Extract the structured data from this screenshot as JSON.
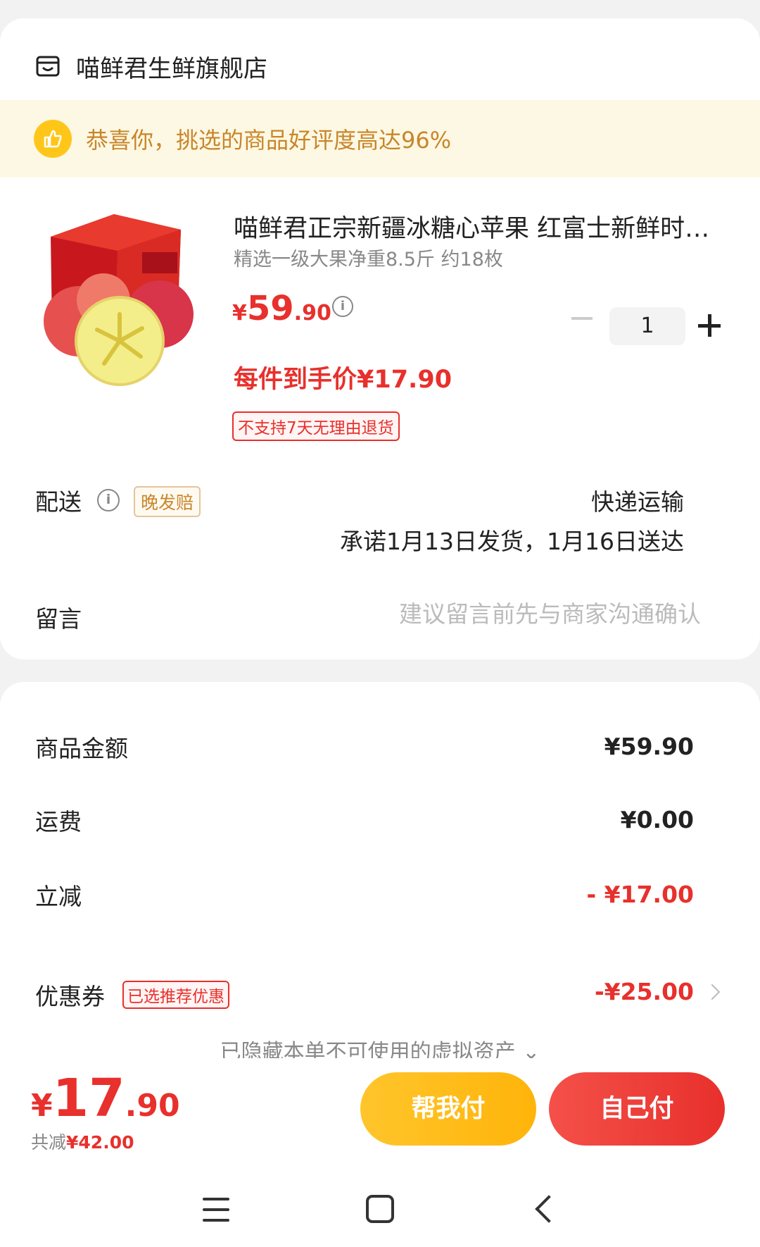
{
  "shop": {
    "name": "喵鲜君生鲜旗舰店",
    "icon": "shop-icon"
  },
  "banner": {
    "text": "恭喜你，挑选的商品好评度高达96%",
    "icon": "thumbs-up-icon"
  },
  "product": {
    "title": "喵鲜君正宗新疆冰糖心苹果 红富士新鲜时令水果",
    "spec": "精选一级大果净重8.5斤 约18枚",
    "price_currency": "¥",
    "price_int": "59",
    "price_dec": ".90",
    "unit_price": "每件到手价¥17.90",
    "return_policy": "不支持7天无理由退货",
    "quantity": "1"
  },
  "shipping": {
    "label": "配送",
    "late_badge": "晚发赔",
    "method": "快递运输",
    "promise": "承诺1月13日发货，1月16日送达"
  },
  "message": {
    "label": "留言",
    "placeholder": "建议留言前先与商家沟通确认",
    "value": ""
  },
  "summary": {
    "goods_label": "商品金额",
    "goods_value": "¥59.90",
    "freight_label": "运费",
    "freight_value": "¥0.00",
    "discount_label": "立减",
    "discount_value": "- ¥17.00",
    "coupon_label": "优惠券",
    "coupon_badge": "已选推荐优惠",
    "coupon_value": "-¥25.00",
    "hidden_assets": "已隐藏本单不可使用的虚拟资产 ⌄"
  },
  "footer": {
    "total_currency": "¥",
    "total_int": "17",
    "total_dec": ".90",
    "saved_prefix": "共减",
    "saved_value": "¥42.00",
    "help_pay": "帮我付",
    "self_pay": "自己付"
  },
  "colors": {
    "accent_red": "#e8302c",
    "accent_yellow": "#ffc61a",
    "banner_bg": "#fdf8e4"
  }
}
